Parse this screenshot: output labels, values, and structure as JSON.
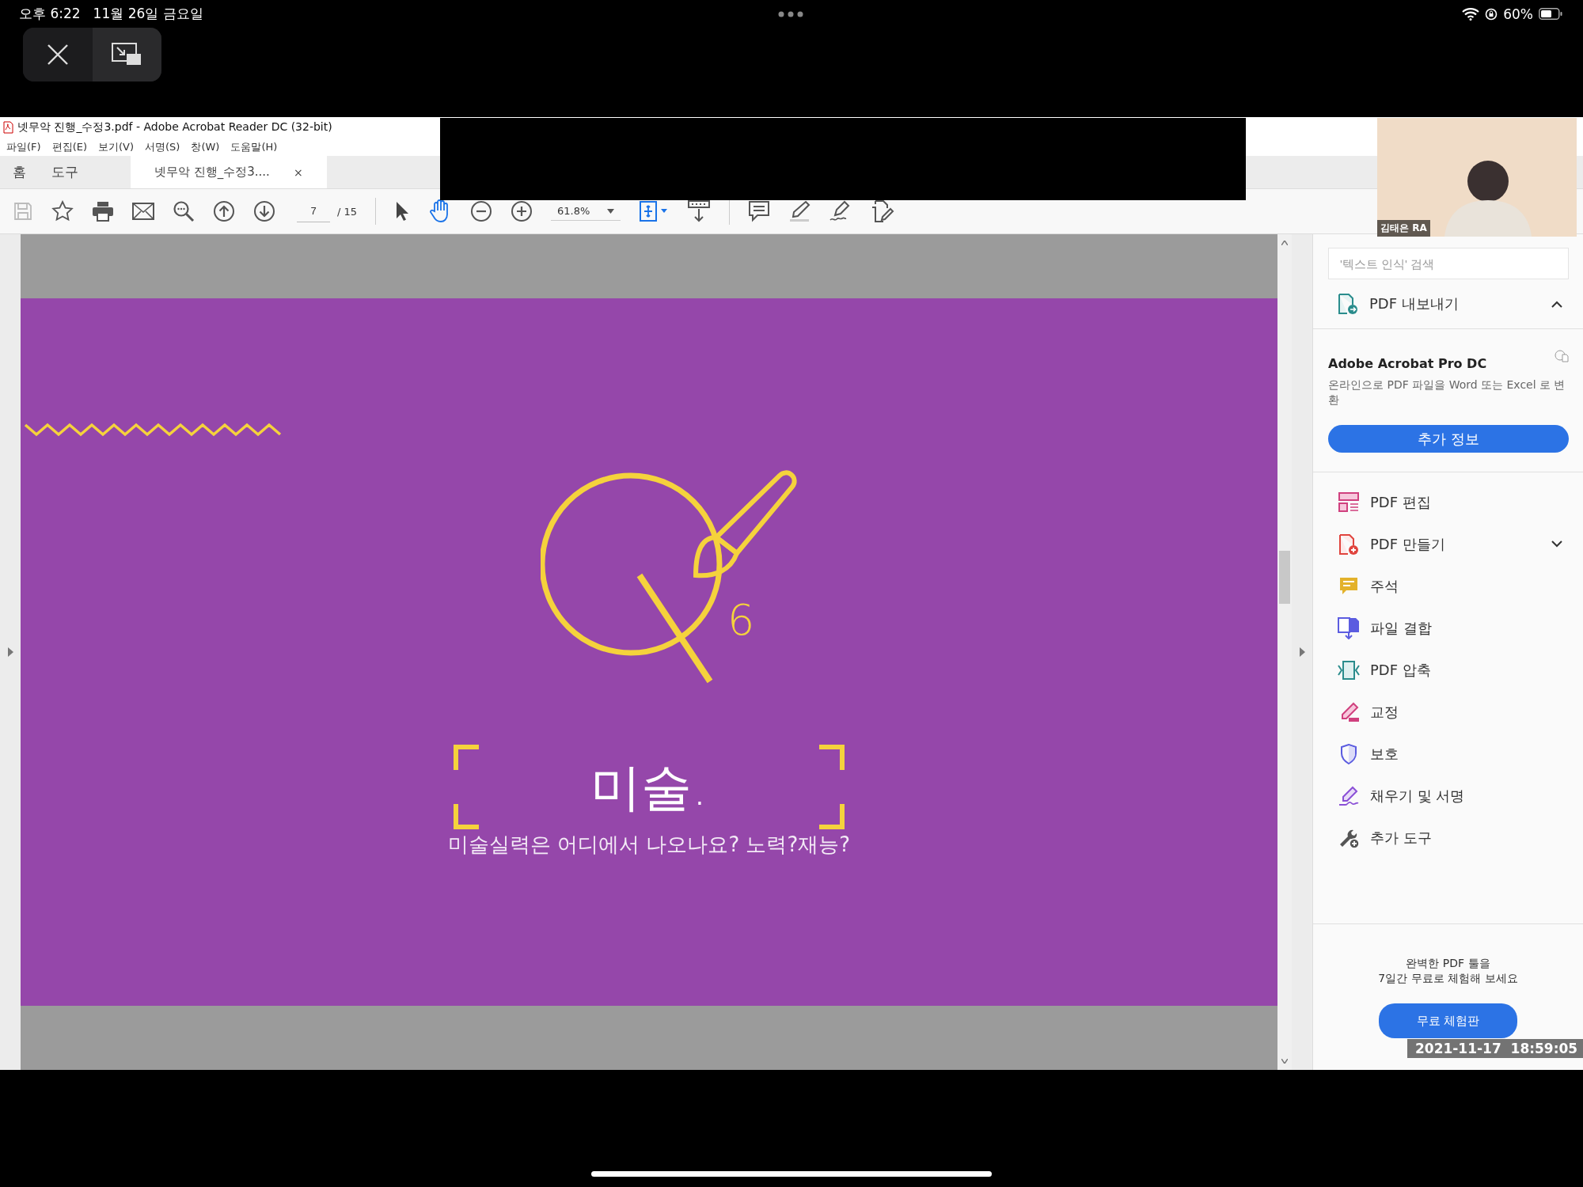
{
  "status_bar": {
    "time": "오후 6:22",
    "date": "11월 26일 금요일",
    "battery": "60%"
  },
  "window": {
    "title": "넷무악 진행_수정3.pdf - Adobe Acrobat Reader DC (32-bit)"
  },
  "menu": [
    "파일(F)",
    "편집(E)",
    "보기(V)",
    "서명(S)",
    "창(W)",
    "도움말(H)"
  ],
  "tabs": [
    {
      "label": "홈",
      "selected": false
    },
    {
      "label": "도구",
      "selected": false
    },
    {
      "label": "넷무악 진행_수정3....",
      "selected": true,
      "close": "×"
    }
  ],
  "toolbar": {
    "page": "7",
    "page_total": "/ 15",
    "zoom": "61.8%",
    "pointer_tools": [
      {
        "selected": false
      },
      {
        "selected": true
      }
    ]
  },
  "slide": {
    "index": "6",
    "title": "미술.",
    "subtitle": "미술실력은 어디에서 나오나요? 노력?재능?"
  },
  "right_panel": {
    "search": {
      "placeholder": "'텍스트 인식' 검색"
    },
    "export": {
      "label": "PDF 내보내기",
      "expanded": true
    },
    "promo": {
      "title": "Adobe Acrobat Pro DC",
      "description": "온라인으로 PDF 파일을 Word 또는 Excel 로 변환",
      "button": "추가 정보"
    },
    "tools": [
      {
        "label": "PDF 편집",
        "kind": "edit"
      },
      {
        "label": "PDF 만들기",
        "kind": "create",
        "expanded": false
      },
      {
        "label": "주석",
        "kind": "comment"
      },
      {
        "label": "파일 결합",
        "kind": "combine"
      },
      {
        "label": "PDF 압축",
        "kind": "compress"
      },
      {
        "label": "교정",
        "kind": "redact"
      },
      {
        "label": "보호",
        "kind": "protect"
      },
      {
        "label": "채우기 및 서명",
        "kind": "sign"
      },
      {
        "label": "추가 도구",
        "kind": "more"
      }
    ],
    "trial": {
      "lines": [
        "완벽한 PDF 툴을",
        "7일간 무료로 체험해 보세요"
      ],
      "button": "무료 체험판"
    }
  },
  "video": {
    "name": "김태은 RA",
    "timestamp": "2021-11-17  18:59:05"
  }
}
